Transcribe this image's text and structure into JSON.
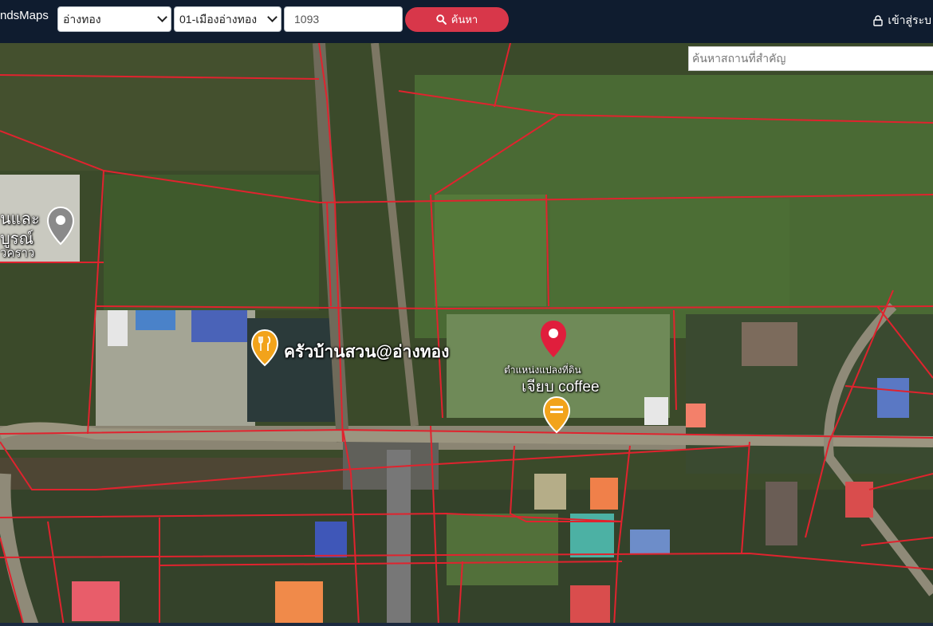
{
  "header": {
    "brand": "ndsMaps",
    "province_select": "อ่างทอง",
    "district_select": "01-เมืองอ่างทอง",
    "parcel_input": "1093",
    "search_button": "ค้นหา",
    "login_label": "เข้าสู่ระบ"
  },
  "map": {
    "place_search_placeholder": "ค้นหาสถานที่สำคัญ",
    "labels": {
      "poi_left_line1": "นและ",
      "poi_left_line2": "บูรณ์",
      "poi_left_line3": "วคราว",
      "restaurant": "ครัวบ้านสวน@อ่างทอง",
      "parcel_marker": "ตำแหน่งแปลงที่ดิน",
      "cafe": "เจียบ coffee"
    },
    "colors": {
      "parcel_lines": "#e0232e",
      "marker_red": "#e01e3c",
      "poi_orange": "#f2a31b",
      "poi_gray": "#8a8a8a"
    }
  }
}
